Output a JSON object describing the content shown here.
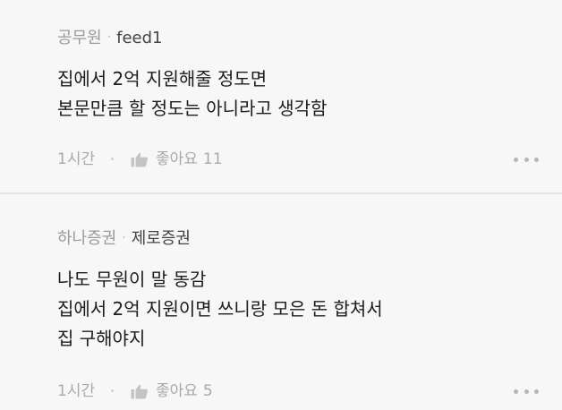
{
  "comments": [
    {
      "org": "공무원",
      "separator": "·",
      "author": "feed1",
      "lines": [
        "집에서 2억 지원해줄 정도면",
        "본문만큼 할 정도는 아니라고 생각함"
      ],
      "time": "1시간",
      "like_label": "좋아요",
      "like_count": "11",
      "like_icon": "thumbs-up-icon",
      "more_icon": "more-options-icon"
    },
    {
      "org": "하나증권",
      "separator": "·",
      "author": "제로증권",
      "lines": [
        "나도 무원이 말 동감",
        "집에서 2억 지원이면 쓰니랑 모은 돈 합쳐서",
        "집 구해야지"
      ],
      "time": "1시간",
      "like_label": "좋아요",
      "like_count": "5",
      "like_icon": "thumbs-up-icon",
      "more_icon": "more-options-icon"
    }
  ],
  "colors": {
    "background": "#f7f7f7",
    "divider": "#e4e4e4",
    "meta_text": "#9a9a9a",
    "body_text": "#1c1c1c"
  }
}
